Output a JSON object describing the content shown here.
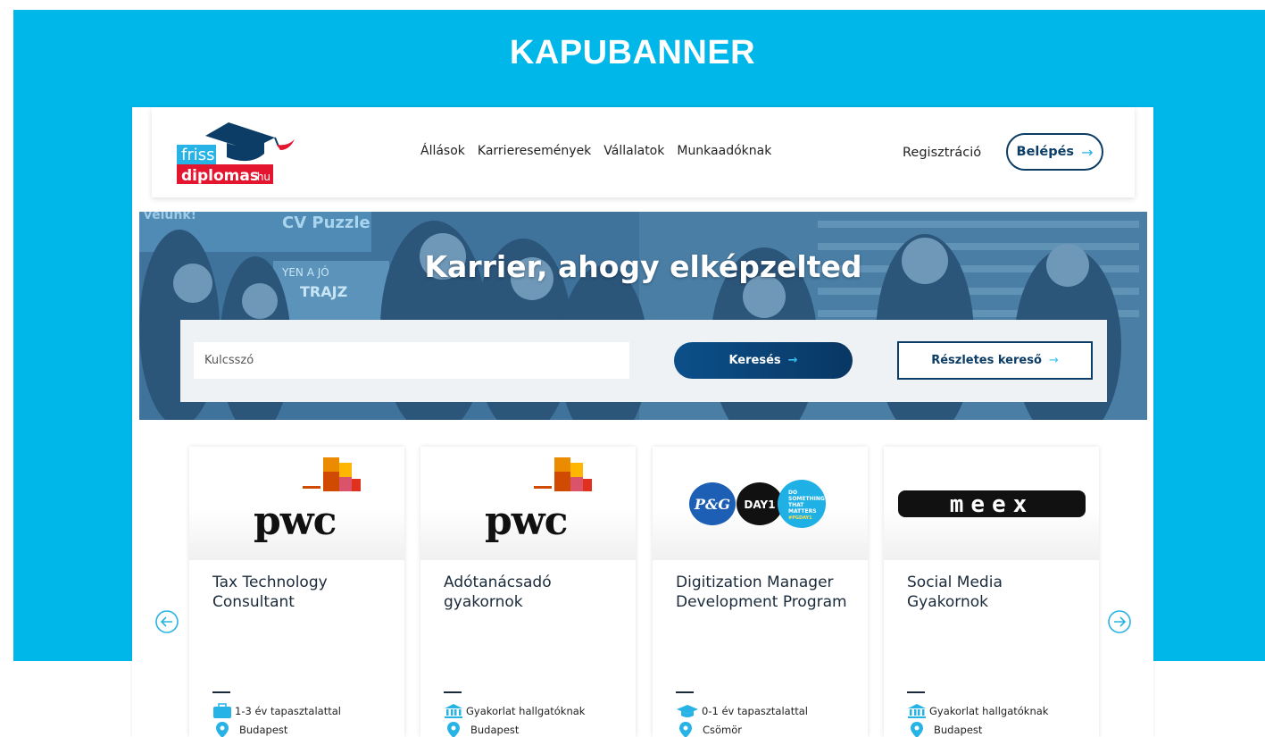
{
  "banner": {
    "title": "KAPUBANNER"
  },
  "logo": {
    "line1": "friss",
    "line2": "diplomas",
    "tld": ".hu"
  },
  "nav": {
    "items": [
      "Állások",
      "Karrieresemények",
      "Vállalatok",
      "Munkaadóknak"
    ]
  },
  "header": {
    "register": "Regisztráció",
    "login": "Belépés"
  },
  "hero": {
    "title": "Karrier, ahogy elképzelted",
    "bg_texts": [
      "CV Puzzle",
      "YEN A JÓ",
      "TRAJZ",
      "velünk!"
    ]
  },
  "search": {
    "placeholder": "Kulcsszó",
    "button": "Keresés",
    "advanced": "Részletes kereső"
  },
  "cards": [
    {
      "company_logo": "pwc",
      "logo_text": "pwc",
      "title": "Tax Technology Consultant",
      "meta": "1-3 év tapasztalattal",
      "meta_icon": "briefcase-icon",
      "location": "Budapest"
    },
    {
      "company_logo": "pwc",
      "logo_text": "pwc",
      "title": "Adótanácsadó gyakornok",
      "meta": "Gyakorlat hallgatóknak",
      "meta_icon": "institution-icon",
      "location": "Budapest"
    },
    {
      "company_logo": "pg",
      "logo_text": "P&G",
      "logo_text2": "DAY1",
      "logo_text3": [
        "DO",
        "SOMETHING",
        "THAT",
        "MATTERS",
        "#PGDAY1"
      ],
      "title": "Digitization Manager Development Program",
      "meta": "0-1 év tapasztalattal",
      "meta_icon": "graduation-cap-icon",
      "location": "Csömör"
    },
    {
      "company_logo": "meex",
      "logo_text": "meex",
      "title": "Social Media Gyakornok",
      "meta": "Gyakorlat hallgatóknak",
      "meta_icon": "institution-icon",
      "location": "Budapest"
    }
  ],
  "colors": {
    "brand_blue": "#00b7ea",
    "navy": "#0b3d66",
    "accent": "#27b3e6",
    "logo_red": "#e3152f"
  }
}
